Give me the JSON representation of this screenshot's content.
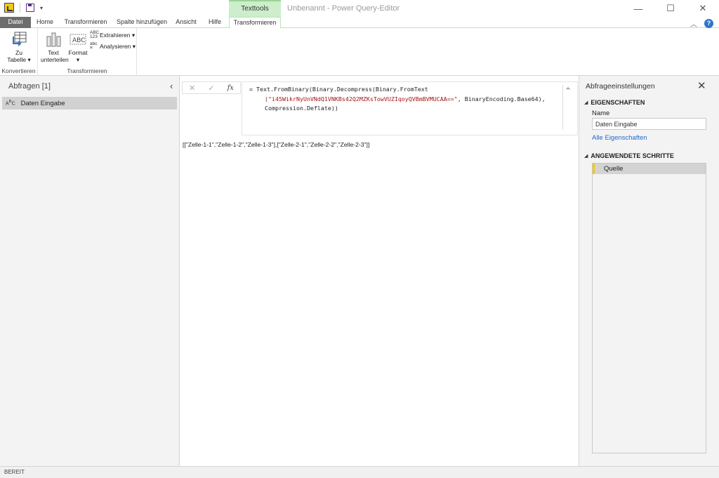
{
  "titlebar": {
    "window_title": "Unbenannt - Power Query-Editor",
    "context_tab": "Texttools",
    "controls": {
      "minimize": "—",
      "maximize": "☐",
      "close": "✕"
    }
  },
  "tabs": {
    "file": "Datei",
    "home": "Home",
    "transform": "Transformieren",
    "add_column": "Spalte hinzufügen",
    "view": "Ansicht",
    "help": "Hilfe",
    "context_transform": "Transformieren"
  },
  "ribbon": {
    "convert": {
      "label": "Konvertieren",
      "to_table_line1": "Zu",
      "to_table_line2": "Tabelle ▾"
    },
    "transform": {
      "label": "Transformieren",
      "split_line1": "Text",
      "split_line2": "unterteilen",
      "format_line1": "Format",
      "format_line2": "▾",
      "extract": "Extrahieren ▾",
      "parse": "Analysieren ▾"
    }
  },
  "queries": {
    "title": "Abfragen [1]",
    "items": [
      {
        "label": "Daten Eingabe",
        "icon": "abc-text-icon"
      }
    ]
  },
  "formula": {
    "line1": "= Text.FromBinary(Binary.Decompress(Binary.FromText",
    "line2_string": "(\"i45WikrNyUnVNdQ1VNKBs42Q2MZKsTowVUZIqoyQVBmBVMUCAA==\"",
    "line2_rest": ", BinaryEncoding.Base64),",
    "line3": "Compression.Deflate))"
  },
  "result": {
    "text": "[[\"Zelle-1-1\",\"Zelle-1-2\",\"Zelle-1-3\"],[\"Zelle-2-1\",\"Zelle-2-2\",\"Zelle-2-3\"]]"
  },
  "settings": {
    "title": "Abfrageeinstellungen",
    "properties_heading": "EIGENSCHAFTEN",
    "name_label": "Name",
    "name_value": "Daten Eingabe",
    "all_properties": "Alle Eigenschaften",
    "steps_heading": "ANGEWENDETE SCHRITTE",
    "steps": [
      "Quelle"
    ]
  },
  "statusbar": {
    "text": "BEREIT"
  },
  "colors": {
    "accent_yellow": "#f2c811",
    "context_green": "#cdeecb",
    "link_blue": "#1e6ac9",
    "string_red": "#a31515"
  }
}
